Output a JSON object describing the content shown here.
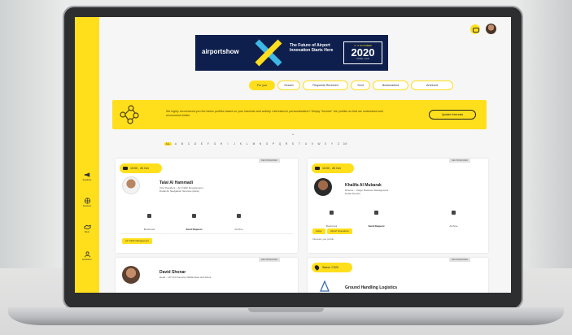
{
  "sidebar": {
    "items": [
      {
        "icon": "megaphone-icon",
        "label": "Speakers"
      },
      {
        "icon": "globe-icon",
        "label": "Sessions"
      },
      {
        "icon": "handshake-icon",
        "label": "Meet"
      },
      {
        "icon": "person-icon",
        "label": "Exhibitors"
      }
    ]
  },
  "banner": {
    "brand": "airportshow",
    "tagline": "The Future of Airport Innovation Starts Here",
    "dates": "3 - 5 OCTOBER",
    "year": "2020",
    "venue": "DUBAI • UAE"
  },
  "tabs": [
    "For you",
    "Search",
    "Requests Received",
    "Sent",
    "Bookmarked",
    "Archived"
  ],
  "recommendation": {
    "text": "We highly recommend you the below profiles based on your interests and activity. Interested in personalization? Simply \"Archive\" the profiles so that we understand and recommend better.",
    "button": "Update Interests"
  },
  "alphabet": [
    "ALL",
    "A",
    "B",
    "C",
    "D",
    "E",
    "F",
    "G",
    "H",
    "I",
    "J",
    "K",
    "L",
    "M",
    "N",
    "O",
    "P",
    "Q",
    "R",
    "S",
    "T",
    "U",
    "V",
    "W",
    "X",
    "Y",
    "Z",
    "0-9"
  ],
  "cards": [
    {
      "pill": "19:00 , 26 Oct",
      "corner": "RECOMMENDED",
      "name": "Talal Al Hammadi",
      "role": "Vice President – Air Traffic Development\nDubai Air Navigation Services (dans)",
      "actions": [
        "Bookmark",
        "Send Request",
        "Archive"
      ],
      "chip": "Air Traffic Management"
    },
    {
      "pill": "10:00 , 26 Oct",
      "corner": "RECOMMENDED",
      "name": "Khalifa Al Mubarak",
      "role": "Director – Cargo Business Management\nDubai Airports",
      "actions": [
        "Bookmark",
        "Send Request",
        "Archive"
      ],
      "chips": [
        "Cargo",
        "Airport Operations"
      ],
      "note": "Interests you profile"
    },
    {
      "corner": "RECOMMENDED",
      "name": "David Shonar",
      "role": "Head – VP Civil Security Middle East and Africa"
    },
    {
      "pill": "Stand: C320",
      "corner": "RECOMMENDED",
      "name": "Ground Handling Logistics"
    }
  ]
}
